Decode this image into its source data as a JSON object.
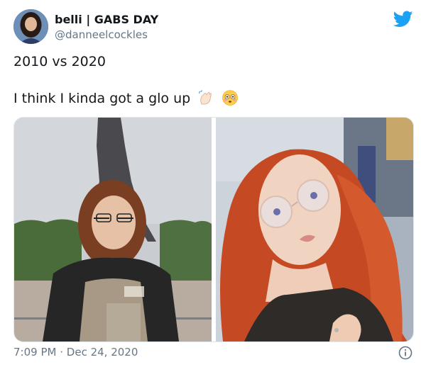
{
  "tweet": {
    "display_name": "belli | GABS DAY",
    "handle": "@danneelcockles",
    "text_line1": "2010 vs 2020",
    "text_line2": "I think I kinda got a glo up",
    "time": "7:09 PM",
    "separator": "·",
    "date": "Dec 24, 2020"
  },
  "icons": {
    "brand": "twitter-bird-icon",
    "emoji1": "waving-hand-emoji",
    "emoji2": "flushed-face-emoji",
    "info": "info-icon"
  },
  "colors": {
    "twitter_blue": "#1da1f2",
    "text_primary": "#14171a",
    "text_secondary": "#657786"
  }
}
